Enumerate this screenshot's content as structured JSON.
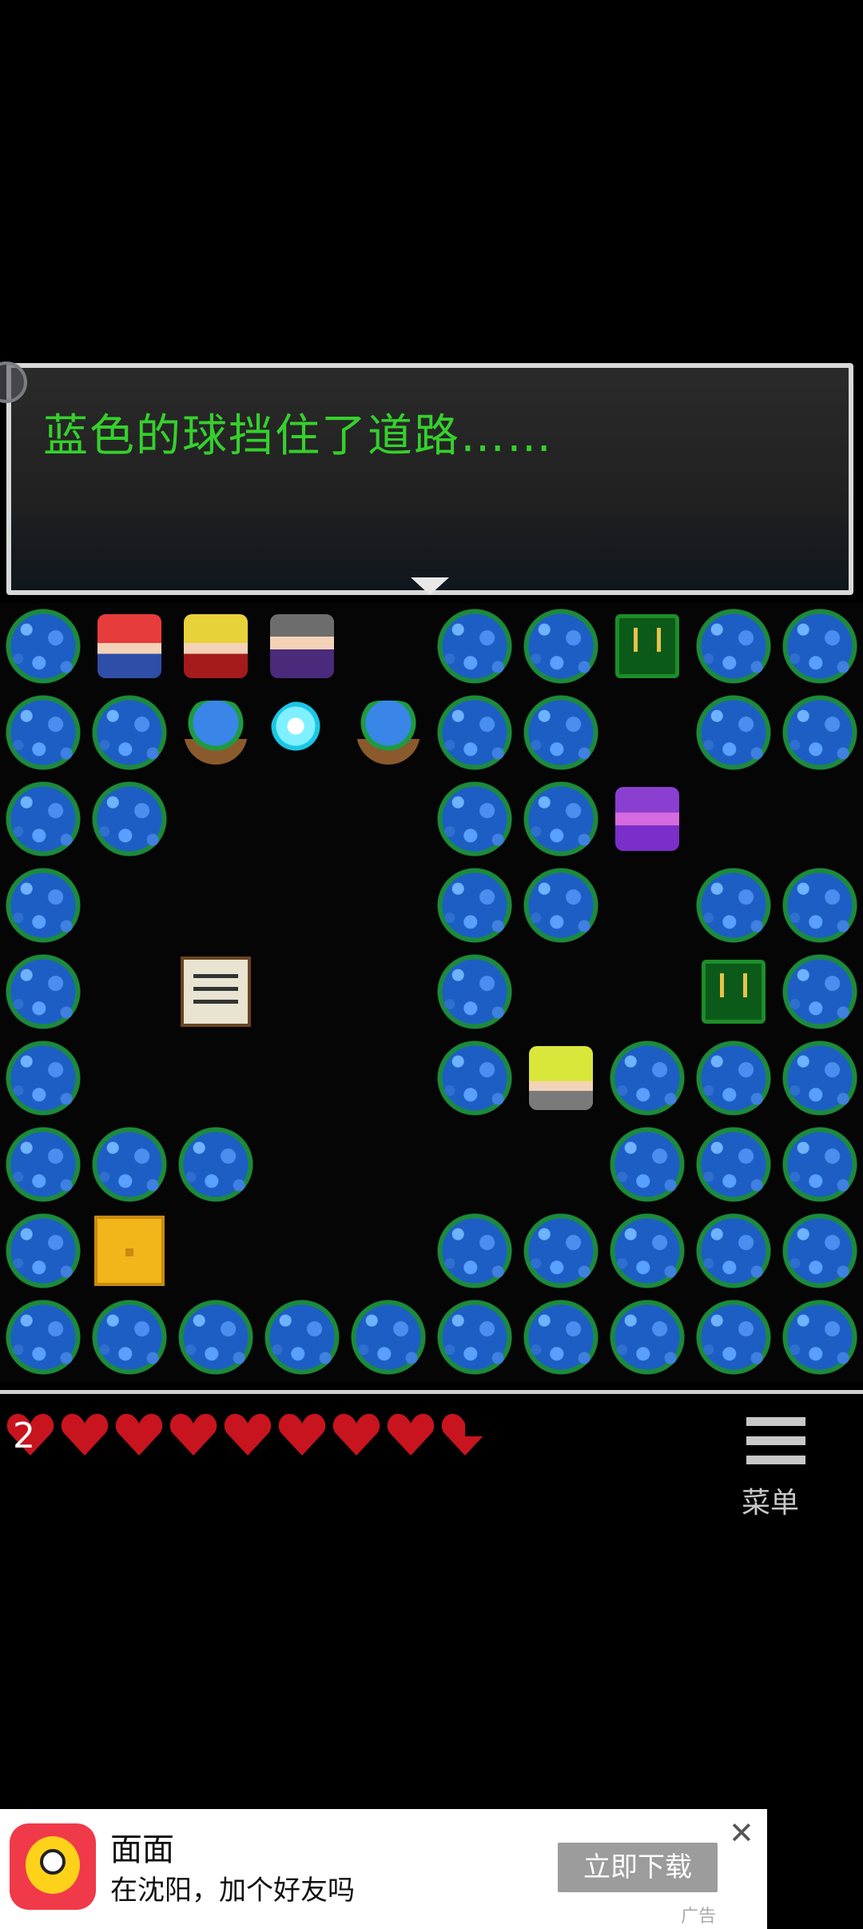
{
  "dialog": {
    "text": "蓝色的球挡住了道路……"
  },
  "status_bar": {
    "hearts_count_label": "2",
    "hearts_full": 8,
    "hearts_partial": 1,
    "colors": {
      "heart": "#c8141e",
      "grass_blue": "#1d5ec4",
      "text_green": "#35d02c"
    }
  },
  "menu": {
    "label": "菜单",
    "icon": "hamburger-icon"
  },
  "ad": {
    "app_name": "面面",
    "subtitle": "在沈阳，加个好友吗",
    "cta": "立即下载",
    "close_icon": "close-icon",
    "tag": "广告"
  }
}
